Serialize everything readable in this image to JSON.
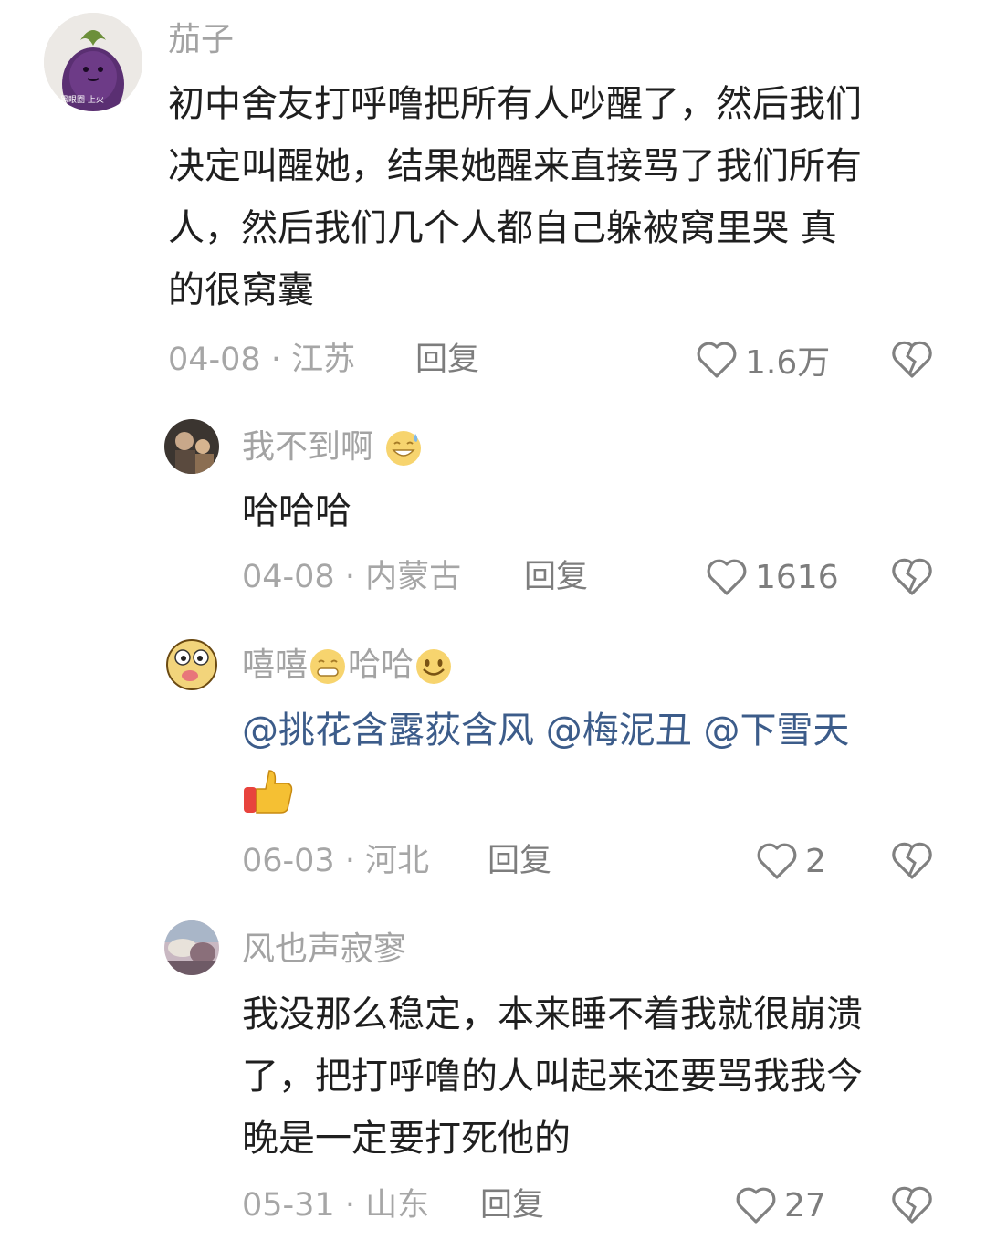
{
  "comments": [
    {
      "nickname": "茄子",
      "avatar_icon": "eggplant-avatar",
      "avatar_text": "黑眼圈  上火",
      "lines": [
        "初中舍友打呼噜把所有人吵醒了，然后我们",
        "决定叫醒她，结果她醒来直接骂了我们所有",
        "人，然后我们几个人都自己躲被窝里哭 真",
        "的很窝囊"
      ],
      "meta": "04-08 · 江苏",
      "reply": "回复",
      "likes": "1.6万"
    },
    {
      "nickname": "我不到啊",
      "nickname_emoji": "sweat-smile-emoji",
      "avatar_icon": "photo-avatar",
      "lines": [
        "哈哈哈"
      ],
      "meta": "04-08 · 内蒙古",
      "reply": "回复",
      "likes": "1616"
    },
    {
      "nickname_a": "嘻嘻",
      "nickname_b": "哈哈",
      "nickname_emojis": [
        "grin-emoji",
        "smile-emoji"
      ],
      "avatar_icon": "cartoon-face-avatar",
      "mentions": [
        "@挑花含露荻含风",
        "@梅泥丑",
        "@下雪天"
      ],
      "trailing_emoji": "thumbs-up-emoji",
      "meta": "06-03 · 河北",
      "reply": "回复",
      "likes": "2"
    },
    {
      "nickname": "风也声寂寥",
      "avatar_icon": "landscape-avatar",
      "lines": [
        "我没那么稳定，本来睡不着我就很崩溃",
        "了，把打呼噜的人叫起来还要骂我我今",
        "晚是一定要打死他的"
      ],
      "meta": "05-31 · 山东",
      "reply": "回复",
      "likes": "27"
    }
  ],
  "colors": {
    "nickname": "#a3a3a3",
    "body": "#1f1f1f",
    "meta": "#a6a6a6",
    "mention": "#3c5c8a"
  }
}
